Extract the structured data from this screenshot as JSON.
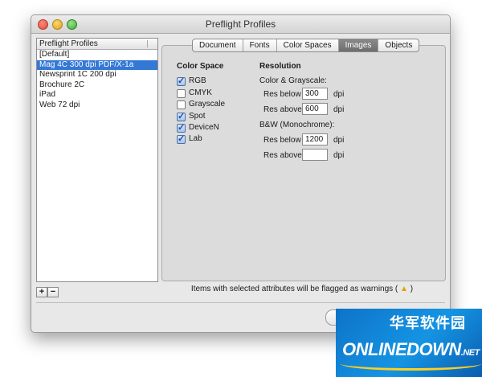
{
  "window": {
    "title": "Preflight Profiles"
  },
  "profiles": {
    "header": "Preflight Profiles",
    "items": [
      "[Default]",
      "Mag 4C 300 dpi PDF/X-1a",
      "Newsprint 1C 200 dpi",
      "Brochure 2C",
      "iPad",
      "Web 72 dpi"
    ],
    "selected_index": 1,
    "add_label": "+",
    "remove_label": "−"
  },
  "tabs": [
    "Document",
    "Fonts",
    "Color Spaces",
    "Images",
    "Objects"
  ],
  "active_tab": "Images",
  "color_space": {
    "title": "Color Space",
    "options": [
      {
        "label": "RGB",
        "checked": true
      },
      {
        "label": "CMYK",
        "checked": false
      },
      {
        "label": "Grayscale",
        "checked": false
      },
      {
        "label": "Spot",
        "checked": true
      },
      {
        "label": "DeviceN",
        "checked": true
      },
      {
        "label": "Lab",
        "checked": true
      }
    ]
  },
  "resolution": {
    "title": "Resolution",
    "color_gray_heading": "Color & Grayscale:",
    "bw_heading": "B&W (Monochrome):",
    "res_below_label": "Res below",
    "res_above_label": "Res above",
    "unit": "dpi",
    "color_below": "300",
    "color_above": "600",
    "bw_below": "1200",
    "bw_above": ""
  },
  "footer_note": {
    "text": "Items with selected attributes will be flagged as warnings (",
    "close": ")"
  },
  "watermark": {
    "chinese": "华军软件园",
    "brand": "ONLINEDOWN",
    "suffix": ".NET"
  }
}
